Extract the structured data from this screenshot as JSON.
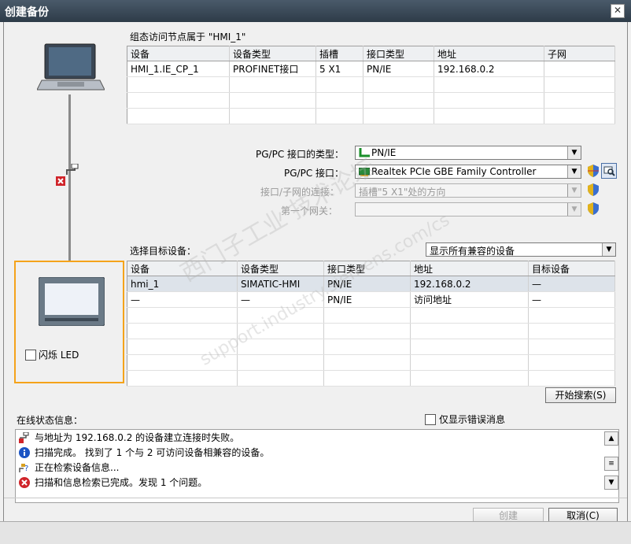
{
  "window": {
    "title": "创建备份",
    "close": "✕"
  },
  "top": {
    "heading": "组态访问节点属于 \"HMI_1\"",
    "columns": [
      "设备",
      "设备类型",
      "插槽",
      "接口类型",
      "地址",
      "子网"
    ],
    "rows": [
      [
        "HMI_1.IE_CP_1",
        "PROFINET接口",
        "5 X1",
        "PN/IE",
        "192.168.0.2",
        ""
      ]
    ]
  },
  "settings": {
    "if_type_label": "PG/PC 接口的类型：",
    "if_type_value": "PN/IE",
    "if_label": "PG/PC 接口：",
    "if_value": "Realtek PCIe GBE Family Controller",
    "conn_label": "接口/子网的连接：",
    "conn_value": "插槽\"5 X1\"处的方向",
    "gateway_label": "第一个网关：",
    "gateway_value": ""
  },
  "target": {
    "label": "选择目标设备：",
    "filter": "显示所有兼容的设备",
    "columns": [
      "设备",
      "设备类型",
      "接口类型",
      "地址",
      "目标设备"
    ],
    "rows": [
      [
        "hmi_1",
        "SIMATIC-HMI",
        "PN/IE",
        "192.168.0.2",
        "—"
      ],
      [
        "—",
        "—",
        "PN/IE",
        "访问地址",
        "—"
      ]
    ]
  },
  "led": {
    "label": "闪烁 LED"
  },
  "search_button": "开始搜索(S)",
  "status": {
    "label": "在线状态信息：",
    "errors_only": "仅显示错误消息",
    "messages": [
      {
        "icon": "connection-error-icon",
        "text": "与地址为 192.168.0.2 的设备建立连接时失败。"
      },
      {
        "icon": "info-icon",
        "text": "扫描完成。 找到了 1 个与 2 可访问设备相兼容的设备。"
      },
      {
        "icon": "search-progress-icon",
        "text": "正在检索设备信息..."
      },
      {
        "icon": "error-icon",
        "text": "扫描和信息检索已完成。发现 1 个问题。"
      }
    ]
  },
  "buttons": {
    "create": "创建",
    "cancel": "取消(C)"
  },
  "watermark": {
    "cn": "西门子工业 技术论坛",
    "url": "support.industry.siemens.com/cs"
  },
  "colors": {
    "accent": "#f5a31a",
    "error": "#d0242a",
    "info": "#1b54c4"
  }
}
